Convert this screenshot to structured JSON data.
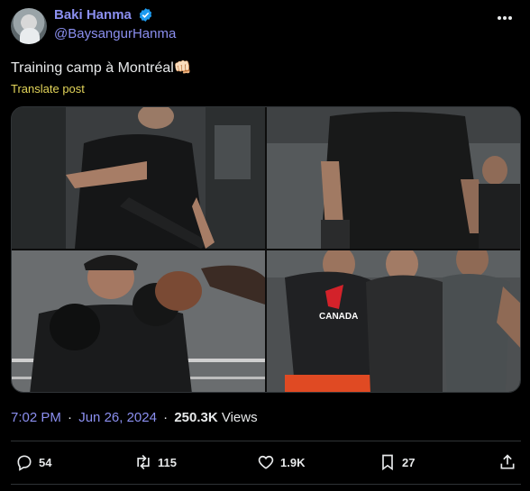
{
  "author": {
    "display_name": "Baki Hanma",
    "handle": "@BaysangurHanma",
    "verified": true
  },
  "tweet": {
    "text": "Training camp à Montréal",
    "emoji": "👊🏻",
    "translate_label": "Translate post"
  },
  "media": {
    "count": 4,
    "tiles": [
      "photo-1",
      "photo-2",
      "photo-3",
      "photo-4"
    ],
    "shirt_text": "CANADA"
  },
  "meta": {
    "time": "7:02 PM",
    "date": "Jun 26, 2024",
    "separator": "·",
    "date_separator": "·",
    "views_count": "250.3K",
    "views_label": "Views"
  },
  "actions": {
    "replies": "54",
    "reposts": "115",
    "likes": "1.9K",
    "bookmarks": "27"
  },
  "colors": {
    "background": "#000000",
    "link": "#8b8ff0",
    "translate": "#e3d55a",
    "verified": "#1d9bf0",
    "text": "#e7e9ea",
    "border": "#2f3336"
  },
  "icons": [
    "avatar",
    "verified-badge-icon",
    "more-icon",
    "reply-icon",
    "repost-icon",
    "like-icon",
    "bookmark-icon",
    "share-icon"
  ]
}
